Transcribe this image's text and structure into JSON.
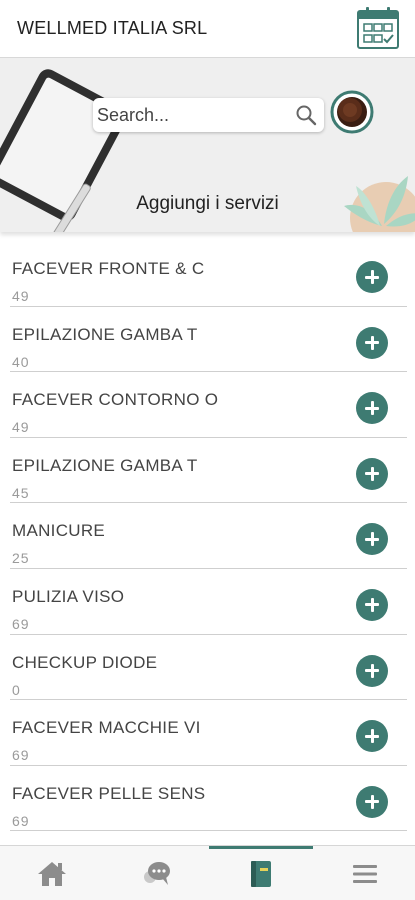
{
  "header": {
    "app_title": "WELLMED ITALIA SRL",
    "calendar_icon": "calendar-check-icon"
  },
  "hero": {
    "search_placeholder": "Search...",
    "title": "Aggiungi i servizi"
  },
  "services": [
    {
      "name": "FACEVER FRONTE & C",
      "price": "49"
    },
    {
      "name": "EPILAZIONE GAMBA T",
      "price": "40"
    },
    {
      "name": "FACEVER CONTORNO O",
      "price": "49"
    },
    {
      "name": "EPILAZIONE GAMBA T",
      "price": "45"
    },
    {
      "name": "MANICURE",
      "price": "25"
    },
    {
      "name": "PULIZIA VISO",
      "price": "69"
    },
    {
      "name": "CHECKUP DIODE",
      "price": "0"
    },
    {
      "name": "FACEVER MACCHIE VI",
      "price": "69"
    },
    {
      "name": "FACEVER PELLE SENS",
      "price": "69"
    }
  ],
  "bottom_nav": {
    "items": [
      "home-icon",
      "chat-icon",
      "services-book-icon",
      "menu-icon"
    ],
    "active_index": 2
  },
  "colors": {
    "accent": "#3e7b72",
    "hero_bg": "#efefef",
    "divider": "#cfcfcf",
    "icon_gray": "#8c8c8c"
  }
}
